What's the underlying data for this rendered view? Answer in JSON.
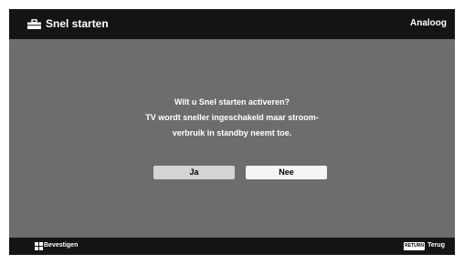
{
  "header": {
    "title": "Snel starten",
    "source": "Analoog",
    "icon": "toolbox-icon"
  },
  "dialog": {
    "lines": [
      "Wilt u Snel starten activeren?",
      "TV wordt sneller ingeschakeld maar stroom-",
      "verbruik in standby neemt toe."
    ],
    "yes_label": "Ja",
    "no_label": "Nee"
  },
  "footer": {
    "confirm_label": "Bevestigen",
    "confirm_icon": "dpad-icon",
    "return_key": "RETURN",
    "back_label": "Terug"
  },
  "colors": {
    "background": "#6d6d6d",
    "bar": "#141414",
    "button_selected": "#d4d4d4",
    "button": "#f4f4f4"
  }
}
